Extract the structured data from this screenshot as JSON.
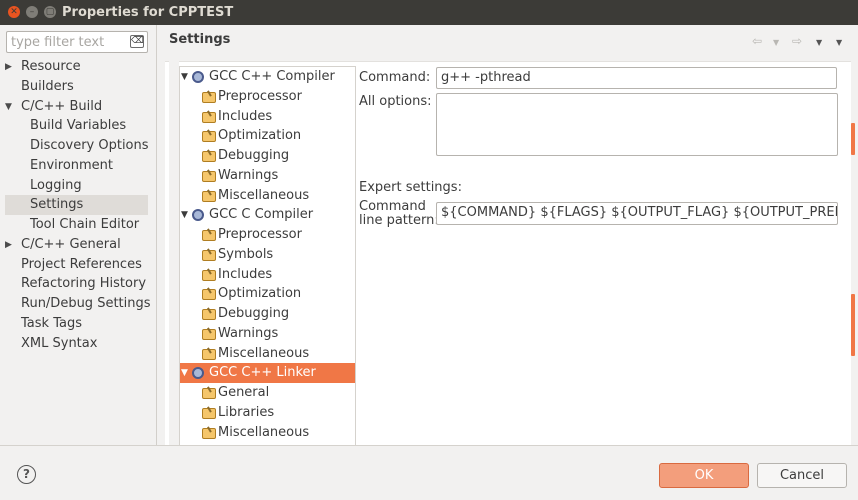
{
  "window": {
    "title": "Properties for CPPTEST",
    "close_glyph": "✕",
    "min_glyph": "–",
    "max_glyph": "▢"
  },
  "filter": {
    "placeholder": "type filter text",
    "clear_glyph": "⌫"
  },
  "nav": {
    "items": [
      {
        "label": "Resource",
        "arrow": "▶"
      },
      {
        "label": "Builders"
      },
      {
        "label": "C/C++ Build",
        "arrow": "▼"
      },
      {
        "label": "Build Variables"
      },
      {
        "label": "Discovery Options"
      },
      {
        "label": "Environment"
      },
      {
        "label": "Logging"
      },
      {
        "label": "Settings"
      },
      {
        "label": "Tool Chain Editor"
      },
      {
        "label": "C/C++ General",
        "arrow": "▶"
      },
      {
        "label": "Project References"
      },
      {
        "label": "Refactoring History"
      },
      {
        "label": "Run/Debug Settings"
      },
      {
        "label": "Task Tags"
      },
      {
        "label": "XML Syntax"
      }
    ]
  },
  "main": {
    "title": "Settings",
    "history": {
      "back": "⇦",
      "forward": "⇨",
      "dropdown": "▼",
      "menu": "▼"
    }
  },
  "tool_tree": {
    "twist_open": "▼",
    "rows": [
      {
        "label": "GCC C++ Compiler",
        "icon": "gear-icon"
      },
      {
        "label": "Preprocessor",
        "icon": "folder-icon"
      },
      {
        "label": "Includes",
        "icon": "folder-icon"
      },
      {
        "label": "Optimization",
        "icon": "folder-icon"
      },
      {
        "label": "Debugging",
        "icon": "folder-icon"
      },
      {
        "label": "Warnings",
        "icon": "folder-icon"
      },
      {
        "label": "Miscellaneous",
        "icon": "folder-icon"
      },
      {
        "label": "GCC C Compiler",
        "icon": "gear-icon"
      },
      {
        "label": "Preprocessor",
        "icon": "folder-icon"
      },
      {
        "label": "Symbols",
        "icon": "folder-icon"
      },
      {
        "label": "Includes",
        "icon": "folder-icon"
      },
      {
        "label": "Optimization",
        "icon": "folder-icon"
      },
      {
        "label": "Debugging",
        "icon": "folder-icon"
      },
      {
        "label": "Warnings",
        "icon": "folder-icon"
      },
      {
        "label": "Miscellaneous",
        "icon": "folder-icon"
      },
      {
        "label": "GCC C++ Linker",
        "icon": "gear-icon"
      },
      {
        "label": "General",
        "icon": "folder-icon"
      },
      {
        "label": "Libraries",
        "icon": "folder-icon"
      },
      {
        "label": "Miscellaneous",
        "icon": "folder-icon"
      }
    ]
  },
  "linker_settings": {
    "command_label": "Command:",
    "command_value": "g++ -pthread",
    "all_options_label": "All options:",
    "all_options_value": "",
    "expert_label": "Expert settings:",
    "pattern_label_1": "Command",
    "pattern_label_2": "line pattern:",
    "pattern_value": "${COMMAND} ${FLAGS} ${OUTPUT_FLAG} ${OUTPUT_PREFIX}${OUTP"
  },
  "footer": {
    "help_glyph": "?",
    "ok_label": "OK",
    "cancel_label": "Cancel"
  },
  "colors": {
    "accent": "#f07746",
    "titlebar": "#3c3b37",
    "ok_button": "#f39e7c"
  }
}
